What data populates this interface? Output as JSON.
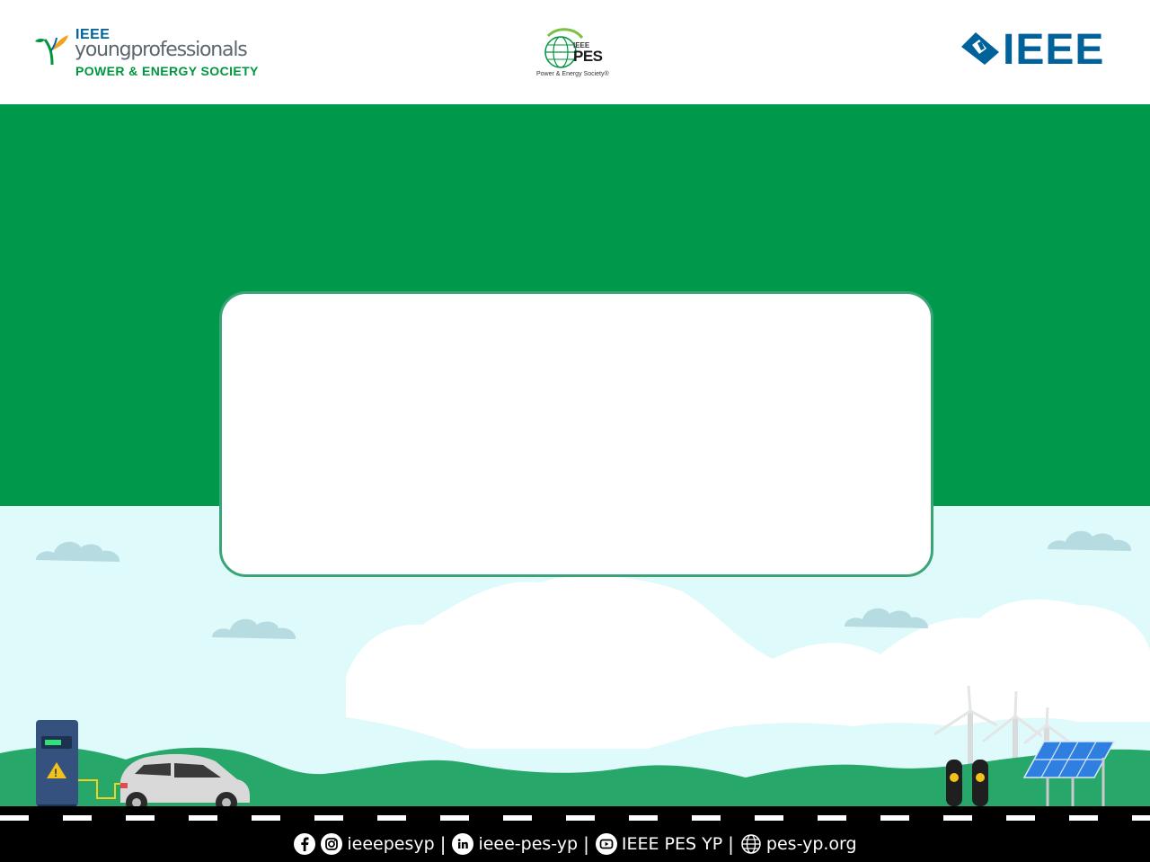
{
  "header": {
    "yp_logo": {
      "ieee": "IEEE",
      "young": "youngprofessionals",
      "society": "POWER & ENERGY SOCIETY"
    },
    "pes_logo": {
      "ieee": "IEEE",
      "pes": "PES",
      "tagline": "Power & Energy Society®"
    },
    "ieee_logo": {
      "wordmark": "IEEE"
    }
  },
  "colors": {
    "green_band": "#00984a",
    "sky": "#dffafb",
    "card_border": "#3aa477",
    "hills": "#27a86a",
    "ieee_blue": "#00629b"
  },
  "scene": {
    "icons": [
      "charging-station-icon",
      "electric-car-icon",
      "cloud-icon",
      "wind-turbine-icon",
      "solar-panel-icon",
      "fuel-pump-icon"
    ]
  },
  "footer": {
    "handle_social": "ieeepesyp",
    "linkedin": "ieee-pes-yp",
    "youtube": "IEEE PES YP",
    "website": "pes-yp.org",
    "separator": "|"
  }
}
